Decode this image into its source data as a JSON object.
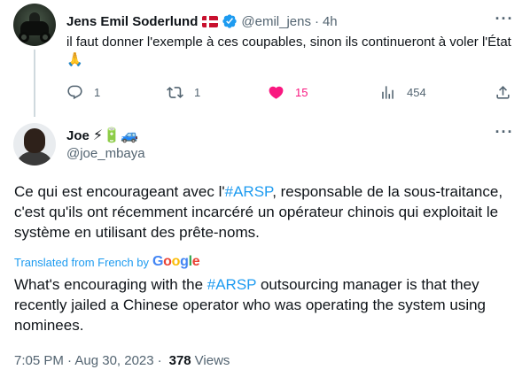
{
  "parent_tweet": {
    "display_name": "Jens Emil Soderlund",
    "handle": "@emil_jens",
    "separator": "·",
    "time": "4h",
    "text": "il faut donner l'exemple à ces coupables, sinon ils continueront à voler l'État 🙏",
    "actions": {
      "reply_count": "1",
      "retweet_count": "1",
      "like_count": "15",
      "views_count": "454"
    },
    "icons": [
      "denmark-flag-icon",
      "verified-badge-icon",
      "more-icon",
      "reply-icon",
      "retweet-icon",
      "like-icon",
      "views-icon",
      "share-icon"
    ],
    "colors": {
      "like": "#f91880",
      "verified": "#1d9bf0"
    }
  },
  "main_tweet": {
    "display_name": "Joe",
    "name_emojis": "⚡🔋🚙",
    "handle": "@joe_mbaya",
    "text_parts": {
      "before": "Ce qui est encourageant avec l'",
      "hashtag": "#ARSP",
      "after": ", responsable de la sous-traitance, c'est qu'ils ont récemment incarcéré un opérateur chinois qui exploitait le système en utilisant des prête-noms."
    },
    "translated_label": "Translated from French by",
    "google_logo": "Google",
    "translation_parts": {
      "before": "What's encouraging with the ",
      "hashtag": "#ARSP",
      "after": " outsourcing manager is that they recently jailed a Chinese operator who was operating the system using nominees."
    },
    "timestamp": "7:05 PM · Aug 30, 2023",
    "separator": "·",
    "views_count": "378",
    "views_label": "Views",
    "colors": {
      "link": "#1d9bf0",
      "muted": "#536471",
      "text": "#0f1419"
    }
  }
}
